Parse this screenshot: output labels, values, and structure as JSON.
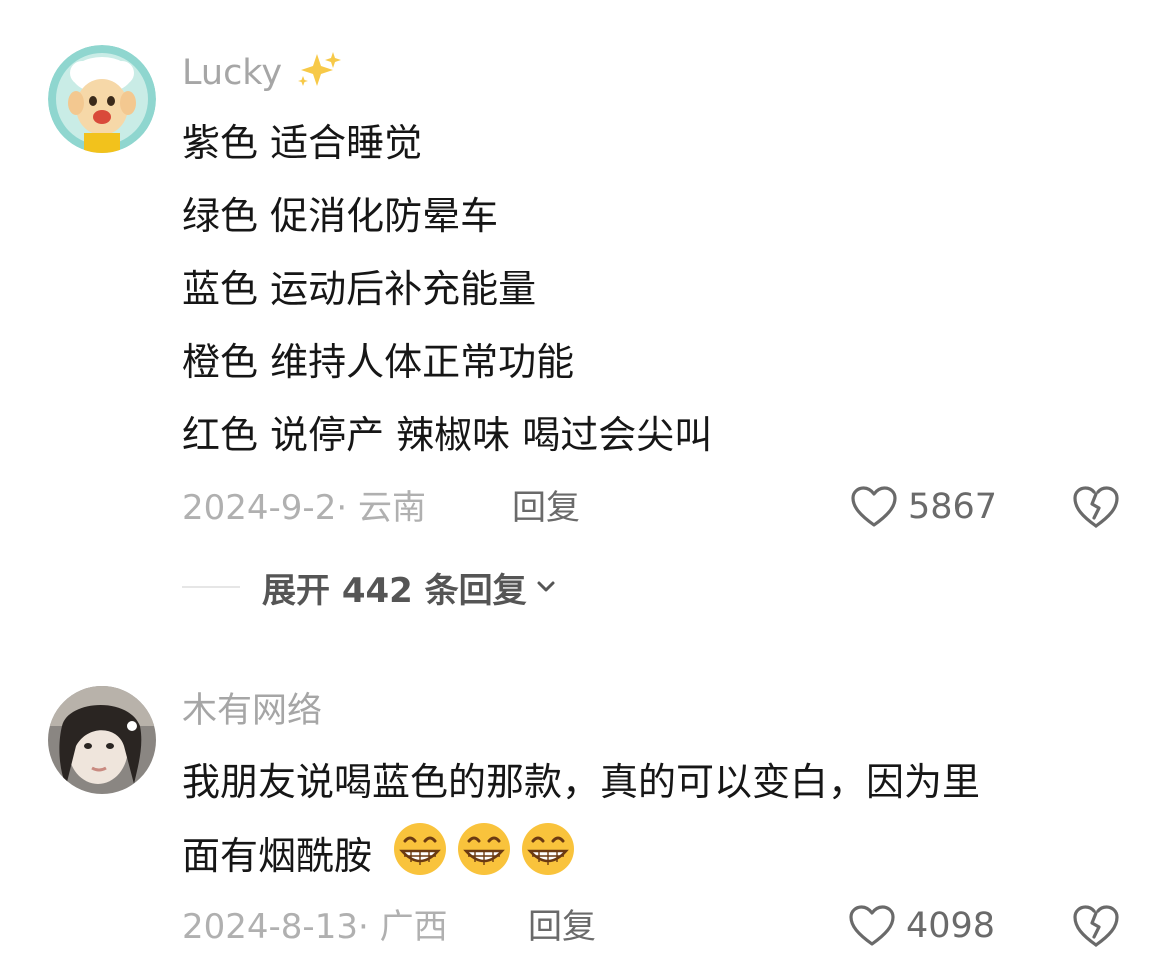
{
  "comments": [
    {
      "username": "Lucky",
      "username_emoji": "sparkles",
      "lines": [
        "紫色 适合睡觉",
        "绿色 促消化防晕车",
        "蓝色 运动后补充能量",
        "橙色 维持人体正常功能",
        "红色 说停产 辣椒味 喝过会尖叫"
      ],
      "date": "2024-9-2",
      "location": "云南",
      "reply_label": "回复",
      "likes": "5867",
      "expand_label": "展开 442 条回复"
    },
    {
      "username": "木有网络",
      "lines": [
        "我朋友说喝蓝色的那款，真的可以变白，因为里",
        "面有烟酰胺"
      ],
      "emojis": [
        "grinning-face",
        "grinning-face",
        "grinning-face"
      ],
      "date": "2024-8-13",
      "location": "广西",
      "reply_label": "回复",
      "likes": "4098"
    }
  ],
  "icons": {
    "like": "heart-outline-icon",
    "dislike": "broken-heart-icon",
    "expand": "chevron-down-icon"
  },
  "colors": {
    "text": "#161616",
    "muted": "#a6a6a6",
    "action": "#6a6a6a"
  }
}
